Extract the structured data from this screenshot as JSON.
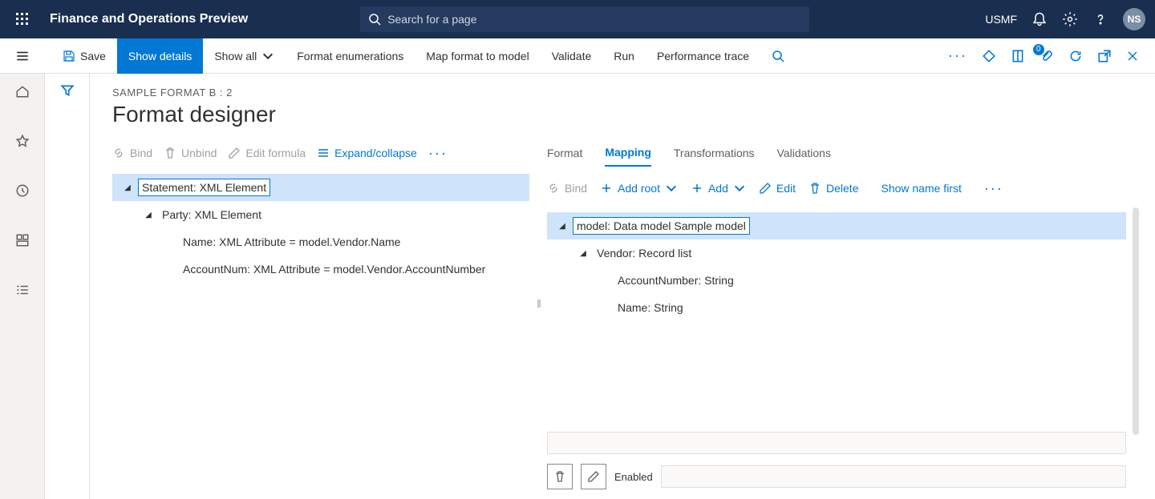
{
  "header": {
    "app_title": "Finance and Operations Preview",
    "search_placeholder": "Search for a page",
    "legal_entity": "USMF",
    "avatar_initials": "NS"
  },
  "cmdbar": {
    "save": "Save",
    "show_details": "Show details",
    "show_all": "Show all",
    "format_enum": "Format enumerations",
    "map_format": "Map format to model",
    "validate": "Validate",
    "run": "Run",
    "perf_trace": "Performance trace",
    "attach_badge": "0"
  },
  "page": {
    "breadcrumb": "SAMPLE FORMAT B : 2",
    "title": "Format designer"
  },
  "left_toolbar": {
    "bind": "Bind",
    "unbind": "Unbind",
    "edit_formula": "Edit formula",
    "expand": "Expand/collapse"
  },
  "left_tree": [
    {
      "level": 0,
      "expanded": true,
      "label": "Statement: XML Element",
      "selected": true,
      "boxed": true
    },
    {
      "level": 1,
      "expanded": true,
      "label": "Party: XML Element"
    },
    {
      "level": 2,
      "label": "Name: XML Attribute = model.Vendor.Name"
    },
    {
      "level": 2,
      "label": "AccountNum: XML Attribute = model.Vendor.AccountNumber"
    }
  ],
  "tabs": {
    "format": "Format",
    "mapping": "Mapping",
    "transformations": "Transformations",
    "validations": "Validations"
  },
  "right_toolbar": {
    "bind": "Bind",
    "add_root": "Add root",
    "add": "Add",
    "edit": "Edit",
    "delete": "Delete",
    "show_name": "Show name first"
  },
  "right_tree": [
    {
      "level": 0,
      "expanded": true,
      "label": "model: Data model Sample model",
      "selected": true,
      "boxed": true
    },
    {
      "level": 1,
      "expanded": true,
      "label": "Vendor: Record list"
    },
    {
      "level": 2,
      "label": "AccountNumber: String"
    },
    {
      "level": 2,
      "label": "Name: String"
    }
  ],
  "props": {
    "enabled_label": "Enabled"
  }
}
